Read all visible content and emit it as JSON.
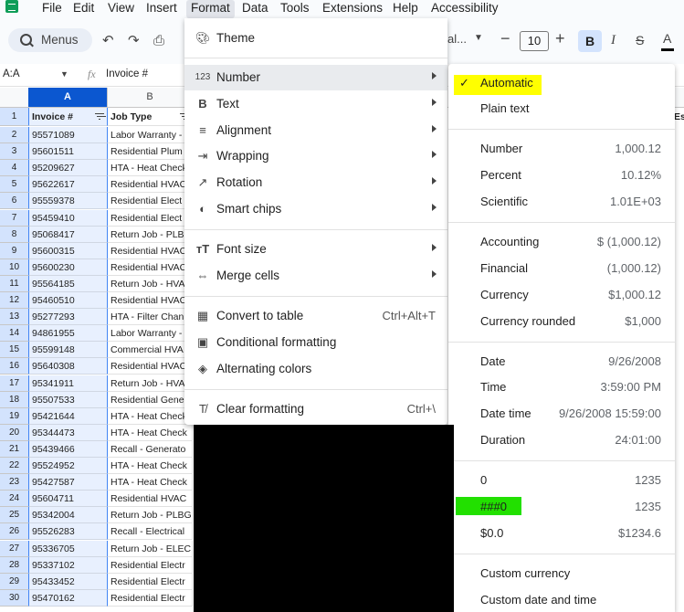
{
  "menubar": {
    "items": [
      "File",
      "Edit",
      "View",
      "Insert",
      "Format",
      "Data",
      "Tools",
      "Extensions",
      "Help",
      "Accessibility"
    ],
    "active": "Format"
  },
  "toolbar": {
    "search_label": "Menus",
    "font_name": "al...",
    "font_size": "10",
    "bold": "B",
    "italic": "I",
    "strike": "S",
    "text_color": "A"
  },
  "formula_bar": {
    "name_box": "A:A",
    "content": "Invoice #"
  },
  "grid": {
    "columns": [
      "A",
      "B"
    ],
    "header": {
      "a": "Invoice #",
      "b": "Job Type"
    },
    "partial_header_right": "Es",
    "rows": [
      {
        "num": "2",
        "a": "95571089",
        "b": "Labor Warranty -"
      },
      {
        "num": "3",
        "a": "95601511",
        "b": "Residential Plum"
      },
      {
        "num": "4",
        "a": "95209627",
        "b": "HTA - Heat Check"
      },
      {
        "num": "5",
        "a": "95622617",
        "b": "Residential HVAC"
      },
      {
        "num": "6",
        "a": "95559378",
        "b": "Residential Elect"
      },
      {
        "num": "7",
        "a": "95459410",
        "b": "Residential Elect"
      },
      {
        "num": "8",
        "a": "95068417",
        "b": "Return Job - PLB"
      },
      {
        "num": "9",
        "a": "95600315",
        "b": "Residential HVAC"
      },
      {
        "num": "10",
        "a": "95600230",
        "b": "Residential HVAC"
      },
      {
        "num": "11",
        "a": "95564185",
        "b": "Return Job - HVA"
      },
      {
        "num": "12",
        "a": "95460510",
        "b": "Residential HVAC"
      },
      {
        "num": "13",
        "a": "95277293",
        "b": "HTA - Filter Chan"
      },
      {
        "num": "14",
        "a": "94861955",
        "b": "Labor Warranty -"
      },
      {
        "num": "15",
        "a": "95599148",
        "b": "Commercial HVA"
      },
      {
        "num": "16",
        "a": "95640308",
        "b": "Residential HVAC"
      },
      {
        "num": "17",
        "a": "95341911",
        "b": "Return Job - HVA"
      },
      {
        "num": "18",
        "a": "95507533",
        "b": "Residential Gene"
      },
      {
        "num": "19",
        "a": "95421644",
        "b": "HTA - Heat Check"
      },
      {
        "num": "20",
        "a": "95344473",
        "b": "HTA - Heat Check"
      },
      {
        "num": "21",
        "a": "95439466",
        "b": "Recall - Generato"
      },
      {
        "num": "22",
        "a": "95524952",
        "b": "HTA - Heat Check"
      },
      {
        "num": "23",
        "a": "95427587",
        "b": "HTA - Heat Check"
      },
      {
        "num": "24",
        "a": "95604711",
        "b": "Residential HVAC"
      },
      {
        "num": "25",
        "a": "95342004",
        "b": "Return Job - PLBG"
      },
      {
        "num": "26",
        "a": "95526283",
        "b": "Recall - Electrical"
      },
      {
        "num": "27",
        "a": "95336705",
        "b": "Return Job - ELEC"
      },
      {
        "num": "28",
        "a": "95337102",
        "b": "Residential Electr"
      },
      {
        "num": "29",
        "a": "95433452",
        "b": "Residential Electr"
      },
      {
        "num": "30",
        "a": "95470162",
        "b": "Residential Electr"
      }
    ]
  },
  "format_menu": {
    "theme": "Theme",
    "number": "Number",
    "text": "Text",
    "alignment": "Alignment",
    "wrapping": "Wrapping",
    "rotation": "Rotation",
    "smart_chips": "Smart chips",
    "font_size": "Font size",
    "merge_cells": "Merge cells",
    "convert_to_table": "Convert to table",
    "convert_shortcut": "Ctrl+Alt+T",
    "conditional_formatting": "Conditional formatting",
    "alternating_colors": "Alternating colors",
    "clear_formatting": "Clear formatting",
    "clear_shortcut": "Ctrl+\\"
  },
  "number_menu": {
    "automatic": "Automatic",
    "plain_text": "Plain text",
    "items": [
      {
        "label": "Number",
        "example": "1,000.12"
      },
      {
        "label": "Percent",
        "example": "10.12%"
      },
      {
        "label": "Scientific",
        "example": "1.01E+03"
      },
      {
        "label": "Accounting",
        "example": "$ (1,000.12)"
      },
      {
        "label": "Financial",
        "example": "(1,000.12)"
      },
      {
        "label": "Currency",
        "example": "$1,000.12"
      },
      {
        "label": "Currency rounded",
        "example": "$1,000"
      },
      {
        "label": "Date",
        "example": "9/26/2008"
      },
      {
        "label": "Time",
        "example": "3:59:00 PM"
      },
      {
        "label": "Date time",
        "example": "9/26/2008 15:59:00"
      },
      {
        "label": "Duration",
        "example": "24:01:00"
      },
      {
        "label": "0",
        "example": "1235"
      },
      {
        "label": "###0",
        "example": "1235"
      },
      {
        "label": "$0.0",
        "example": "$1234.6"
      },
      {
        "label": "Custom currency",
        "example": ""
      },
      {
        "label": "Custom date and time",
        "example": ""
      }
    ]
  },
  "colors": {
    "selected_column": "#0b57d0",
    "highlight_yellow": "#ffff00",
    "highlight_green": "#22e000"
  }
}
